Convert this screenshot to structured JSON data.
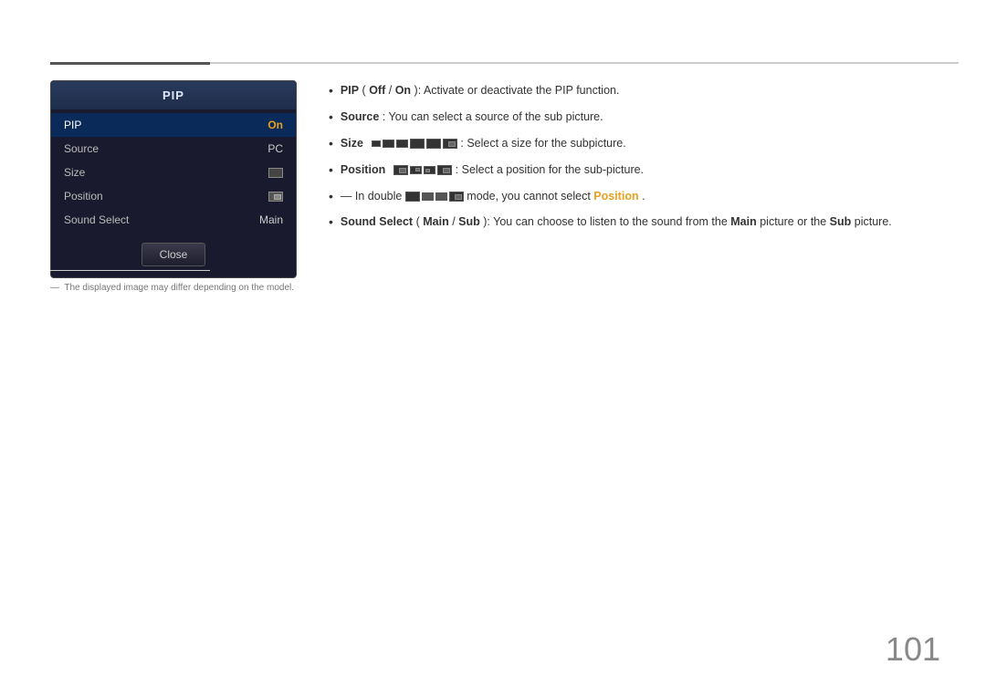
{
  "page": {
    "number": "101"
  },
  "header": {
    "section": "PIP"
  },
  "pip_box": {
    "title": "PIP",
    "menu_items": [
      {
        "label": "PIP",
        "value": "On",
        "active": true,
        "value_color": "orange"
      },
      {
        "label": "Source",
        "value": "PC",
        "active": false
      },
      {
        "label": "Size",
        "value": "",
        "active": false,
        "has_icon": true
      },
      {
        "label": "Position",
        "value": "",
        "active": false,
        "has_icon": true
      },
      {
        "label": "Sound Select",
        "value": "Main",
        "active": false
      }
    ],
    "close_button": "Close"
  },
  "note": {
    "text": "The displayed image may differ depending on the model."
  },
  "bullets": [
    {
      "id": "pip-off-on",
      "prefix_bold": "PIP",
      "prefix_extra": " (",
      "off_bold": "Off",
      "slash": " / ",
      "on_bold": "On",
      "suffix": "): Activate or deactivate the PIP function."
    },
    {
      "id": "source",
      "prefix_bold": "Source",
      "suffix": ": You can select a source of the sub picture."
    },
    {
      "id": "size",
      "prefix_bold": "Size",
      "suffix": ": Select a size for the subpicture.",
      "has_size_icons": true
    },
    {
      "id": "position",
      "prefix_bold": "Position",
      "suffix": ": Select a position for the sub-picture.",
      "has_pos_icons": true
    },
    {
      "id": "double-mode",
      "prefix": "In double ",
      "suffix": " mode, you cannot select ",
      "position_bold": "Position",
      "suffix2": ".",
      "has_double_icons": true
    },
    {
      "id": "sound-select",
      "prefix_bold": "Sound Select",
      "prefix_extra": " (",
      "main_bold": "Main",
      "slash": " / ",
      "sub_bold": "Sub",
      "suffix": "): You can choose to listen to the sound from the ",
      "main_bold2": "Main",
      "suffix2": " picture or the ",
      "sub_bold2": "Sub",
      "suffix3": " picture."
    }
  ]
}
